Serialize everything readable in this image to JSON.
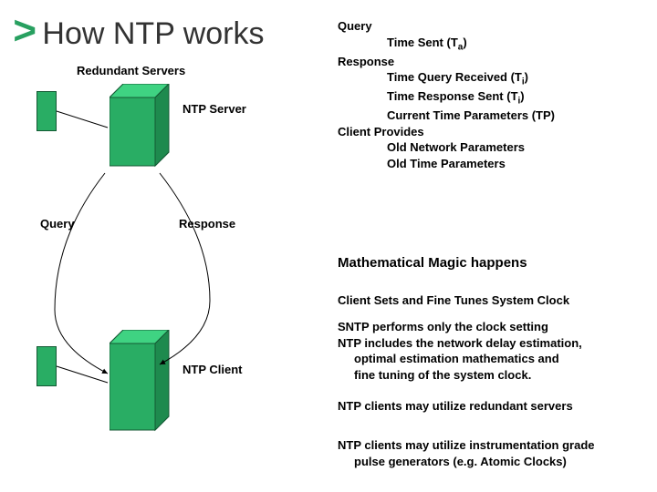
{
  "title": "How NTP works",
  "labels": {
    "redundant_servers": "Redundant Servers",
    "ntp_server": "NTP Server",
    "query": "Query",
    "response": "Response",
    "ntp_client": "NTP Client"
  },
  "right": {
    "query_hdr": "Query",
    "query_line": "Time Sent  (T",
    "query_sub": "a",
    "query_tail": ")",
    "response_hdr": "Response",
    "resp1": "Time Query Received (T",
    "resp1_sub": "i",
    "resp1_tail": ")",
    "resp2": "Time Response Sent (T",
    "resp2_sub": "i",
    "resp2_tail": ")",
    "resp3": "Current Time Parameters (TP)",
    "client_provides_hdr": "Client Provides",
    "cp1": "Old Network Parameters",
    "cp2": "Old Time Parameters",
    "math_magic": "Mathematical Magic happens",
    "client_sets": "Client  Sets and Fine Tunes System Clock",
    "sntp1": "SNTP performs only the clock setting",
    "sntp2": "NTP includes the network delay estimation,",
    "sntp3": "optimal estimation mathematics and",
    "sntp4": "fine tuning of the system clock.",
    "redund_line": "NTP clients may utilize redundant servers",
    "instr1": "NTP clients may utilize instrumentation grade",
    "instr2": "pulse generators (e.g. Atomic Clocks)"
  },
  "colors": {
    "accent": "#29ad64",
    "stroke": "#145a34"
  }
}
